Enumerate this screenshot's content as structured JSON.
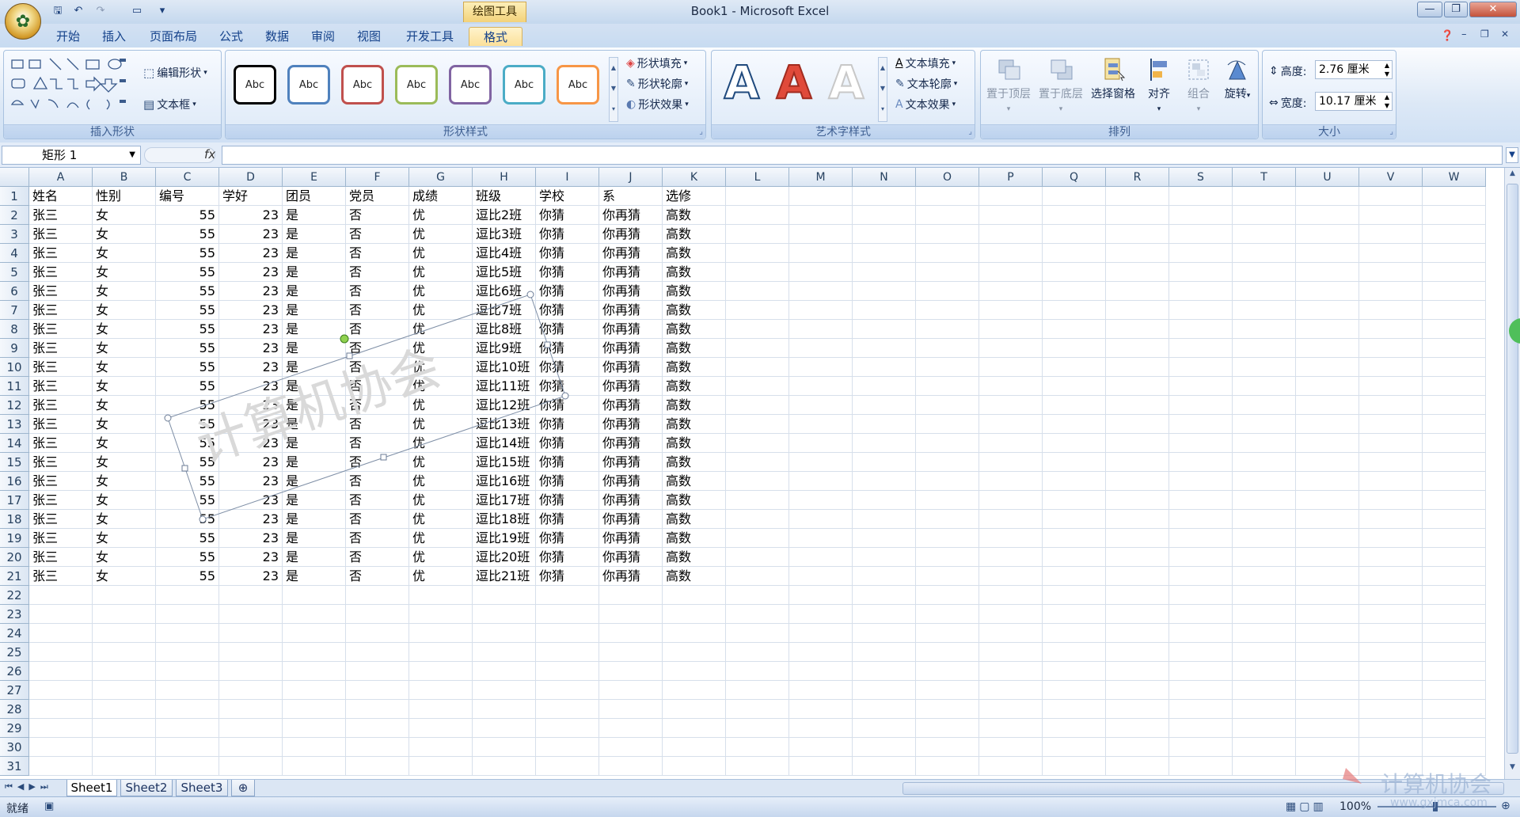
{
  "window": {
    "title": "Book1 - Microsoft Excel",
    "context_tab": "绘图工具",
    "office_button": "Office"
  },
  "tabs": [
    "开始",
    "插入",
    "页面布局",
    "公式",
    "数据",
    "审阅",
    "视图",
    "开发工具",
    "格式"
  ],
  "active_tab": "格式",
  "ribbon": {
    "insert_shapes": {
      "label": "插入形状",
      "edit_shape": "编辑形状",
      "text_box": "文本框"
    },
    "shape_styles": {
      "label": "形状样式",
      "styles": [
        {
          "text": "Abc",
          "color": "#000000"
        },
        {
          "text": "Abc",
          "color": "#4f81bd"
        },
        {
          "text": "Abc",
          "color": "#c0504d"
        },
        {
          "text": "Abc",
          "color": "#9bbb59"
        },
        {
          "text": "Abc",
          "color": "#8064a2"
        },
        {
          "text": "Abc",
          "color": "#4bacc6"
        },
        {
          "text": "Abc",
          "color": "#f79646"
        }
      ],
      "fill": "形状填充",
      "outline": "形状轮廓",
      "effects": "形状效果"
    },
    "wordart": {
      "label": "艺术字样式",
      "samples": [
        {
          "text": "A",
          "color": "#ffffff",
          "stroke": "#1f497d"
        },
        {
          "text": "A",
          "color": "#e04a3a",
          "stroke": "#a12b1f"
        },
        {
          "text": "A",
          "color": "#ffffff",
          "stroke": "#c8c8c8"
        }
      ],
      "text_fill": "文本填充",
      "text_outline": "文本轮廓",
      "text_effects": "文本效果"
    },
    "arrange": {
      "label": "排列",
      "bring_front": "置于顶层",
      "send_back": "置于底层",
      "selection_pane": "选择窗格",
      "align": "对齐",
      "group": "组合",
      "rotate": "旋转"
    },
    "size": {
      "label": "大小",
      "height_label": "高度:",
      "height_value": "2.76 厘米",
      "width_label": "宽度:",
      "width_value": "10.17 厘米"
    }
  },
  "formula_bar": {
    "name_box": "矩形 1",
    "fx": "fx",
    "value": ""
  },
  "columns": [
    "A",
    "B",
    "C",
    "D",
    "E",
    "F",
    "G",
    "H",
    "I",
    "J",
    "K",
    "L",
    "M",
    "N",
    "O",
    "P",
    "Q",
    "R",
    "S",
    "T",
    "U",
    "V",
    "W"
  ],
  "row_count": 31,
  "header_row": [
    "姓名",
    "性别",
    "编号",
    "学好",
    "团员",
    "党员",
    "成绩",
    "班级",
    "学校",
    "系",
    "选修"
  ],
  "rows": [
    [
      "张三",
      "女",
      "55",
      "23",
      "是",
      "否",
      "优",
      "逗比2班",
      "你猜",
      "你再猜",
      "高数"
    ],
    [
      "张三",
      "女",
      "55",
      "23",
      "是",
      "否",
      "优",
      "逗比3班",
      "你猜",
      "你再猜",
      "高数"
    ],
    [
      "张三",
      "女",
      "55",
      "23",
      "是",
      "否",
      "优",
      "逗比4班",
      "你猜",
      "你再猜",
      "高数"
    ],
    [
      "张三",
      "女",
      "55",
      "23",
      "是",
      "否",
      "优",
      "逗比5班",
      "你猜",
      "你再猜",
      "高数"
    ],
    [
      "张三",
      "女",
      "55",
      "23",
      "是",
      "否",
      "优",
      "逗比6班",
      "你猜",
      "你再猜",
      "高数"
    ],
    [
      "张三",
      "女",
      "55",
      "23",
      "是",
      "否",
      "优",
      "逗比7班",
      "你猜",
      "你再猜",
      "高数"
    ],
    [
      "张三",
      "女",
      "55",
      "23",
      "是",
      "否",
      "优",
      "逗比8班",
      "你猜",
      "你再猜",
      "高数"
    ],
    [
      "张三",
      "女",
      "55",
      "23",
      "是",
      "否",
      "优",
      "逗比9班",
      "你猜",
      "你再猜",
      "高数"
    ],
    [
      "张三",
      "女",
      "55",
      "23",
      "是",
      "否",
      "优",
      "逗比10班",
      "你猜",
      "你再猜",
      "高数"
    ],
    [
      "张三",
      "女",
      "55",
      "23",
      "是",
      "否",
      "优",
      "逗比11班",
      "你猜",
      "你再猜",
      "高数"
    ],
    [
      "张三",
      "女",
      "55",
      "23",
      "是",
      "否",
      "优",
      "逗比12班",
      "你猜",
      "你再猜",
      "高数"
    ],
    [
      "张三",
      "女",
      "55",
      "23",
      "是",
      "否",
      "优",
      "逗比13班",
      "你猜",
      "你再猜",
      "高数"
    ],
    [
      "张三",
      "女",
      "55",
      "23",
      "是",
      "否",
      "优",
      "逗比14班",
      "你猜",
      "你再猜",
      "高数"
    ],
    [
      "张三",
      "女",
      "55",
      "23",
      "是",
      "否",
      "优",
      "逗比15班",
      "你猜",
      "你再猜",
      "高数"
    ],
    [
      "张三",
      "女",
      "55",
      "23",
      "是",
      "否",
      "优",
      "逗比16班",
      "你猜",
      "你再猜",
      "高数"
    ],
    [
      "张三",
      "女",
      "55",
      "23",
      "是",
      "否",
      "优",
      "逗比17班",
      "你猜",
      "你再猜",
      "高数"
    ],
    [
      "张三",
      "女",
      "55",
      "23",
      "是",
      "否",
      "优",
      "逗比18班",
      "你猜",
      "你再猜",
      "高数"
    ],
    [
      "张三",
      "女",
      "55",
      "23",
      "是",
      "否",
      "优",
      "逗比19班",
      "你猜",
      "你再猜",
      "高数"
    ],
    [
      "张三",
      "女",
      "55",
      "23",
      "是",
      "否",
      "优",
      "逗比20班",
      "你猜",
      "你再猜",
      "高数"
    ],
    [
      "张三",
      "女",
      "55",
      "23",
      "是",
      "否",
      "优",
      "逗比21班",
      "你猜",
      "你再猜",
      "高数"
    ]
  ],
  "numeric_columns": [
    2,
    3
  ],
  "watermark_shape": {
    "text": "计算机协会",
    "color": "#d9d9d9"
  },
  "sheets": [
    "Sheet1",
    "Sheet2",
    "Sheet3"
  ],
  "active_sheet": "Sheet1",
  "status": {
    "ready": "就绪",
    "zoom": "100%"
  },
  "corner_watermark": {
    "logo_text": "计算机协会",
    "url": "www.gxjmca.com"
  }
}
